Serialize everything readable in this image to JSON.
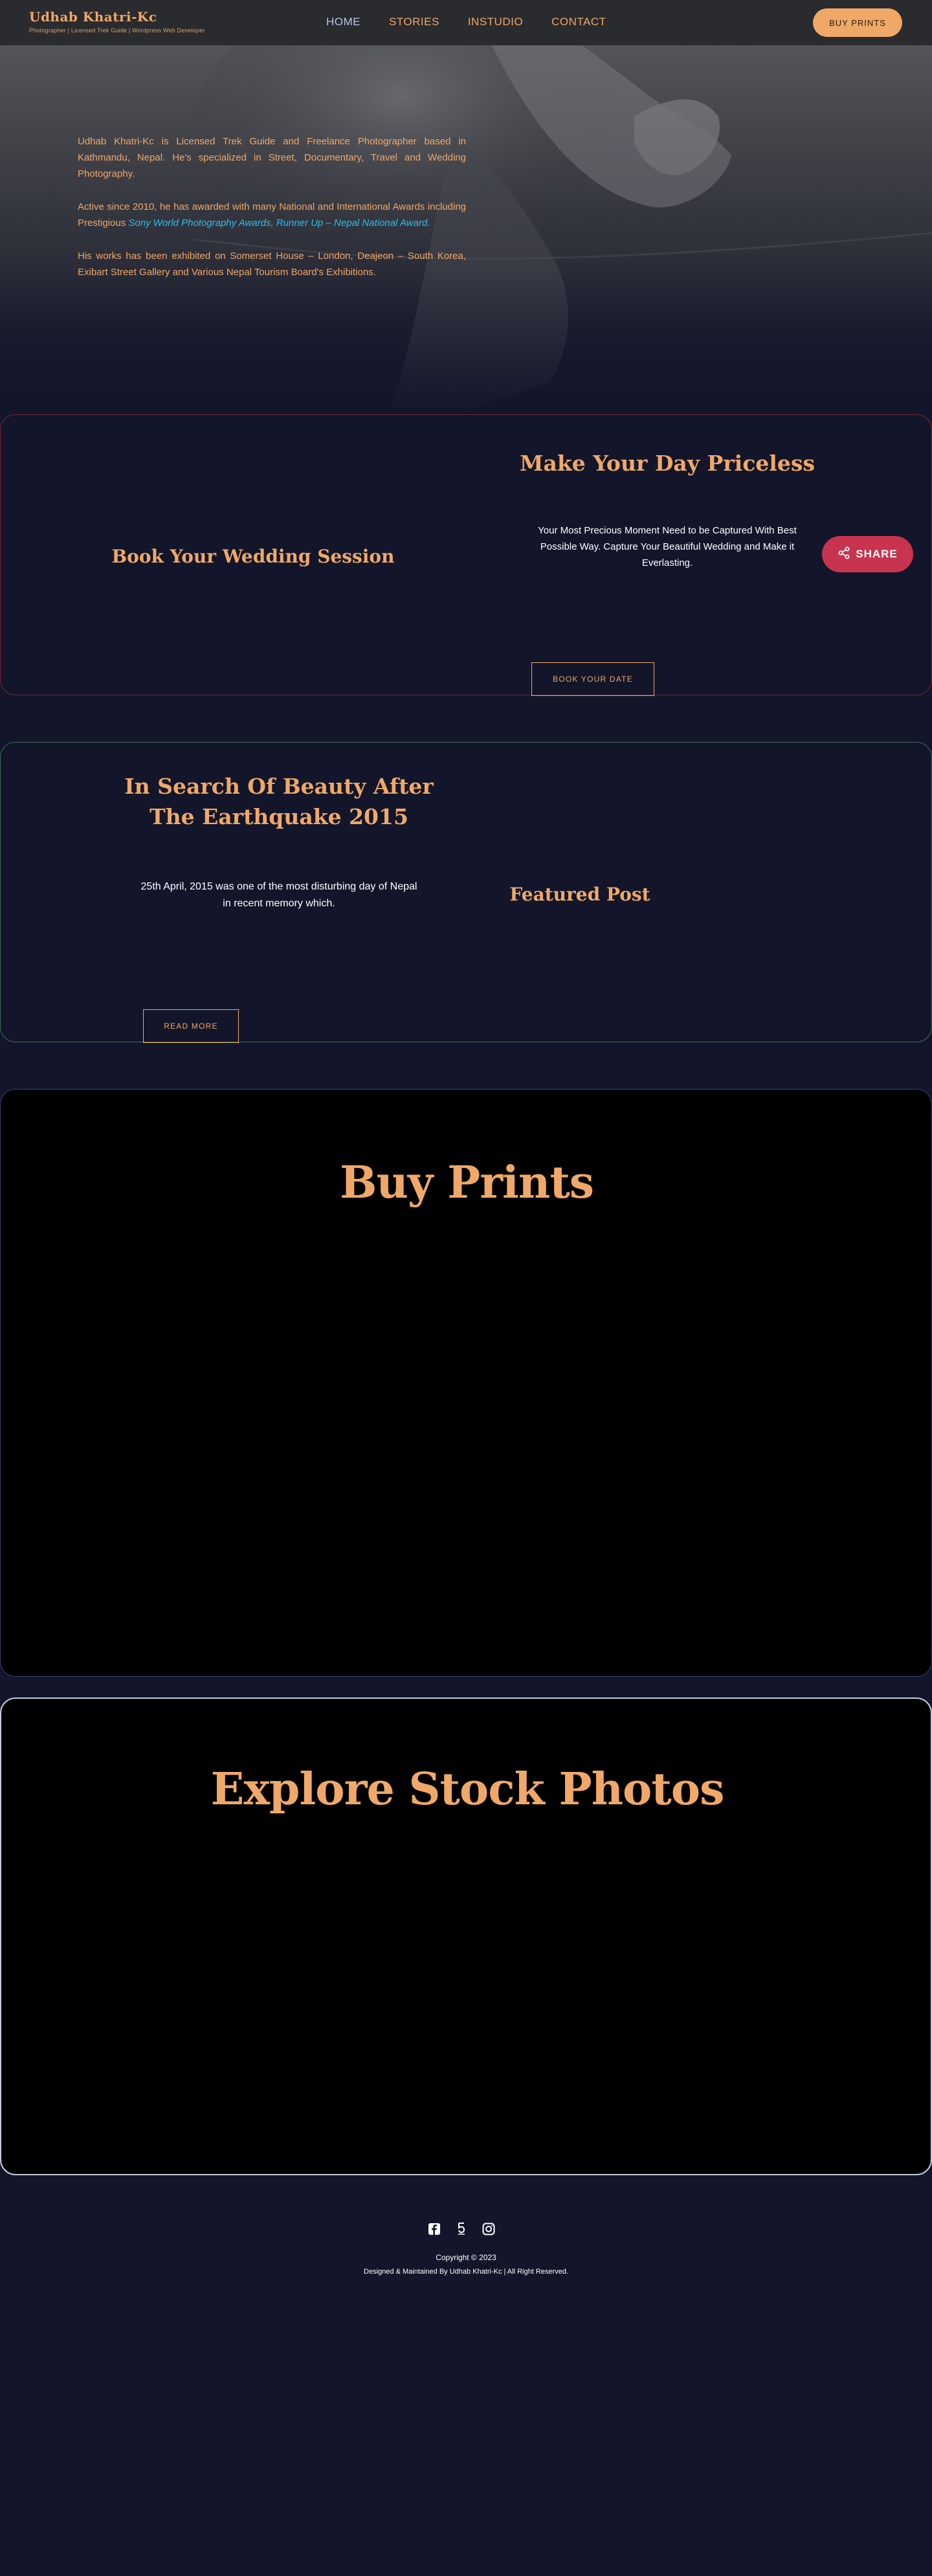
{
  "nav": {
    "brand_name": "Udhab Khatri-Kc",
    "brand_tagline": "Photographer | Licensed Trek Guide | Wordpress Web Developer",
    "items": [
      {
        "label": "HOME",
        "active": true
      },
      {
        "label": "STORIES",
        "active": false
      },
      {
        "label": "INSTUDIO",
        "active": false
      },
      {
        "label": "CONTACT",
        "active": false
      }
    ],
    "cta_label": "BUY PRINTS"
  },
  "hero": {
    "para1": "Udhab Khatri-Kc is Licensed Trek Guide and Freelance Photographer based in Kathmandu, Nepal. He's specialized in Street, Documentary, Travel and Wedding Photography.",
    "para2_pre": "Active since 2010, he has awarded with many National and International Awards including Prestigious ",
    "para2_highlight": "Sony World Photography Awards, Runner Up – Nepal National Award.",
    "para3": "His works has been exhibited on Somerset House – London, Deajeon – South Korea, Exibart Street Gallery and Various Nepal Tourism Board's Exhibitions."
  },
  "wedding": {
    "left_title": "Book Your Wedding Session",
    "right_title": "Make Your Day Priceless",
    "description": "Your Most Precious Moment Need to be Captured With Best Possible Way. Capture Your Beautiful Wedding and Make it Everlasting.",
    "button_label": "BOOK YOUR DATE"
  },
  "share": {
    "label": "SHARE"
  },
  "quake": {
    "title": "In Search Of Beauty After The Earthquake 2015",
    "description": "25th April, 2015 was one of the most disturbing day of Nepal in recent memory which.",
    "button_label": "READ MORE",
    "featured_label": "Featured Post"
  },
  "prints": {
    "title": "Buy Prints"
  },
  "stock": {
    "title": "Explore Stock Photos"
  },
  "footer": {
    "icons": [
      "facebook-icon",
      "fivehundredpx-icon",
      "instagram-icon"
    ],
    "copyright": "Copyright © 2023",
    "credit": "Designed & Maintained By Udhab Khatri-Kc | All Right Reserved."
  },
  "colors": {
    "accent": "#f0a868",
    "background": "#13162a",
    "share": "#c8344f",
    "link_highlight": "#27c0ee"
  }
}
